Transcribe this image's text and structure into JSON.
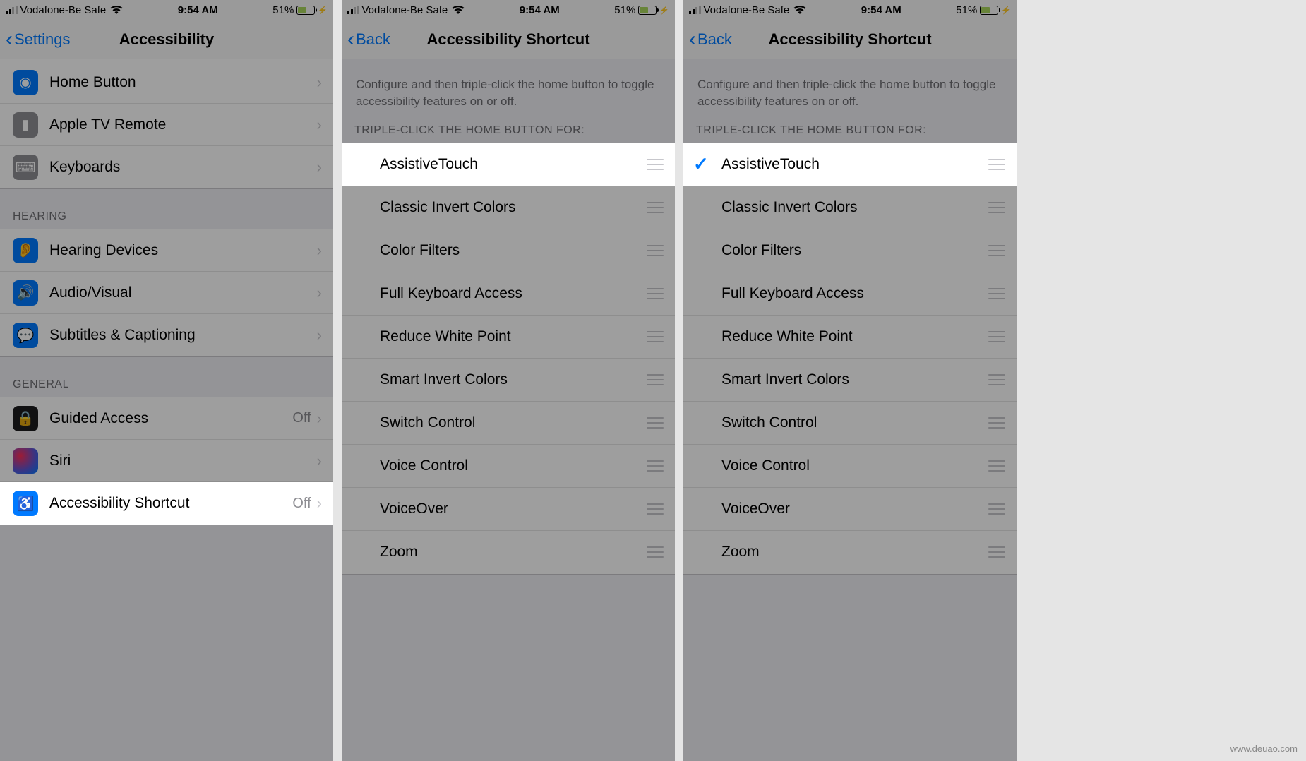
{
  "status": {
    "carrier": "Vodafone-Be Safe",
    "time": "9:54 AM",
    "battery_pct": "51%"
  },
  "panel1": {
    "back_label": "Settings",
    "title": "Accessibility",
    "rows_top": [
      {
        "label": "Home Button",
        "icon": "home-button-icon"
      },
      {
        "label": "Apple TV Remote",
        "icon": "apple-tv-remote-icon"
      },
      {
        "label": "Keyboards",
        "icon": "keyboard-icon"
      }
    ],
    "section_hearing": "HEARING",
    "rows_hearing": [
      {
        "label": "Hearing Devices",
        "icon": "ear-icon"
      },
      {
        "label": "Audio/Visual",
        "icon": "speaker-icon"
      },
      {
        "label": "Subtitles & Captioning",
        "icon": "caption-icon"
      }
    ],
    "section_general": "GENERAL",
    "rows_general": [
      {
        "label": "Guided Access",
        "value": "Off",
        "icon": "lock-icon"
      },
      {
        "label": "Siri",
        "icon": "siri-icon"
      },
      {
        "label": "Accessibility Shortcut",
        "value": "Off",
        "icon": "accessibility-icon",
        "highlight": true
      }
    ]
  },
  "panel2": {
    "back_label": "Back",
    "title": "Accessibility Shortcut",
    "description": "Configure and then triple-click the home button to toggle accessibility features on or off.",
    "section": "TRIPLE-CLICK THE HOME BUTTON FOR:",
    "items": [
      {
        "label": "AssistiveTouch",
        "checked": false,
        "highlight": true
      },
      {
        "label": "Classic Invert Colors"
      },
      {
        "label": "Color Filters"
      },
      {
        "label": "Full Keyboard Access"
      },
      {
        "label": "Reduce White Point"
      },
      {
        "label": "Smart Invert Colors"
      },
      {
        "label": "Switch Control"
      },
      {
        "label": "Voice Control"
      },
      {
        "label": "VoiceOver"
      },
      {
        "label": "Zoom"
      }
    ]
  },
  "panel3": {
    "back_label": "Back",
    "title": "Accessibility Shortcut",
    "description": "Configure and then triple-click the home button to toggle accessibility features on or off.",
    "section": "TRIPLE-CLICK THE HOME BUTTON FOR:",
    "items": [
      {
        "label": "AssistiveTouch",
        "checked": true,
        "highlight": true
      },
      {
        "label": "Classic Invert Colors"
      },
      {
        "label": "Color Filters"
      },
      {
        "label": "Full Keyboard Access"
      },
      {
        "label": "Reduce White Point"
      },
      {
        "label": "Smart Invert Colors"
      },
      {
        "label": "Switch Control"
      },
      {
        "label": "Voice Control"
      },
      {
        "label": "VoiceOver"
      },
      {
        "label": "Zoom"
      }
    ]
  },
  "watermark": "www.deuao.com"
}
